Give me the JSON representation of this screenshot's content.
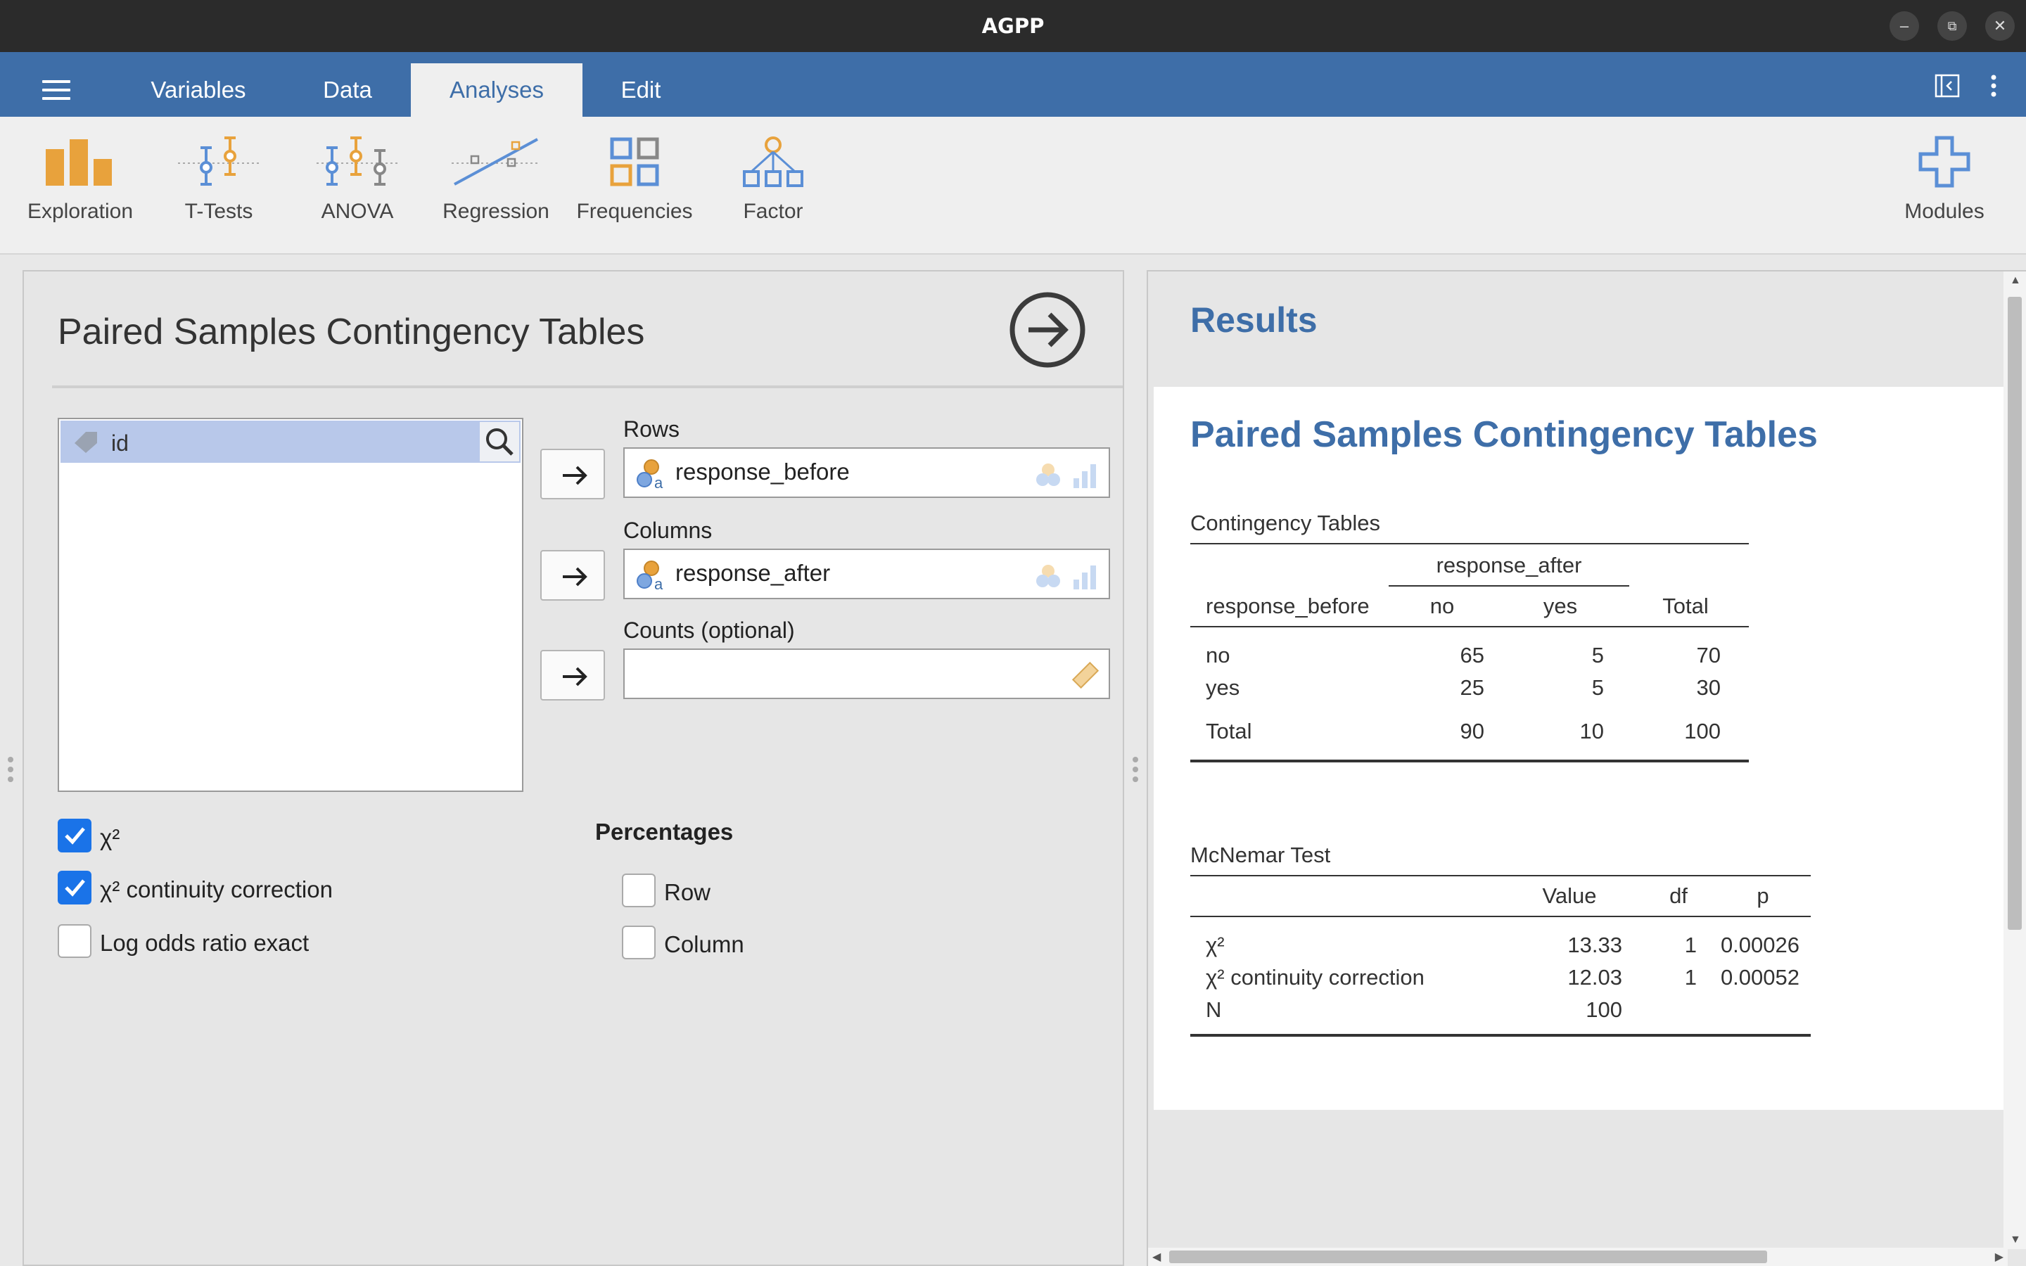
{
  "window": {
    "title": "AGPP",
    "minimize": "–",
    "restore": "⧉",
    "close": "✕"
  },
  "menubar": {
    "tabs": [
      {
        "label": "Variables"
      },
      {
        "label": "Data"
      },
      {
        "label": "Analyses"
      },
      {
        "label": "Edit"
      }
    ],
    "active_tab": "Analyses"
  },
  "ribbon": {
    "items": [
      {
        "label": "Exploration",
        "icon": "bar-chart-icon"
      },
      {
        "label": "T-Tests",
        "icon": "t-test-icon"
      },
      {
        "label": "ANOVA",
        "icon": "anova-icon"
      },
      {
        "label": "Regression",
        "icon": "regression-icon"
      },
      {
        "label": "Frequencies",
        "icon": "frequencies-icon"
      },
      {
        "label": "Factor",
        "icon": "factor-icon"
      }
    ],
    "modules_label": "Modules"
  },
  "analysis": {
    "title": "Paired Samples Contingency Tables",
    "variables": [
      "id"
    ],
    "rows_label": "Rows",
    "rows_value": "response_before",
    "columns_label": "Columns",
    "columns_value": "response_after",
    "counts_label": "Counts (optional)",
    "counts_value": "",
    "options": {
      "chi2": {
        "label": "χ²",
        "checked": true
      },
      "chi2_cc": {
        "label": "χ² continuity correction",
        "checked": true
      },
      "log_odds": {
        "label": "Log odds ratio exact",
        "checked": false
      }
    },
    "percentages": {
      "heading": "Percentages",
      "row": {
        "label": "Row",
        "checked": false
      },
      "column": {
        "label": "Column",
        "checked": false
      }
    }
  },
  "results": {
    "heading": "Results",
    "title": "Paired Samples Contingency Tables",
    "contingency": {
      "caption": "Contingency Tables",
      "spanner": "response_after",
      "row_header": "response_before",
      "col_headers": [
        "no",
        "yes",
        "Total"
      ],
      "rows": [
        {
          "label": "no",
          "values": [
            "65",
            "5",
            "70"
          ]
        },
        {
          "label": "yes",
          "values": [
            "25",
            "5",
            "30"
          ]
        },
        {
          "label": "Total",
          "values": [
            "90",
            "10",
            "100"
          ]
        }
      ]
    },
    "mcnemar": {
      "caption": "McNemar Test",
      "col_headers": [
        "Value",
        "df",
        "p"
      ],
      "rows": [
        {
          "label": "χ²",
          "value": "13.33",
          "df": "1",
          "p": "0.00026"
        },
        {
          "label": "χ² continuity correction",
          "value": "12.03",
          "df": "1",
          "p": "0.00052"
        },
        {
          "label": "N",
          "value": "100",
          "df": "",
          "p": ""
        }
      ]
    }
  },
  "colors": {
    "brand": "#3e6ea8",
    "checkbox_checked": "#1a73e8",
    "icon_orange": "#e8a23c",
    "icon_blue": "#5b8fd6"
  }
}
